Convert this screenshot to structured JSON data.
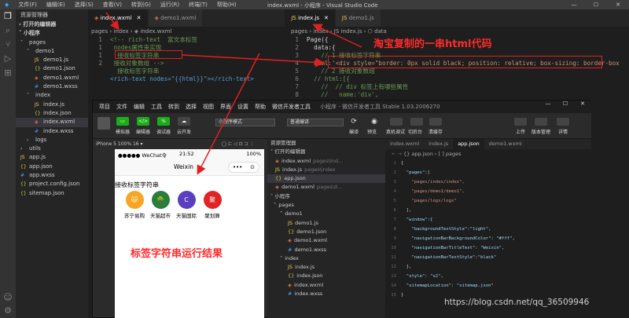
{
  "vscode": {
    "menu": [
      "文件(F)",
      "编辑(E)",
      "选择(S)",
      "查看(V)",
      "转到(G)",
      "运行(R)",
      "终端(T)",
      "帮助(H)"
    ],
    "title": "index.wxml - 小程序 - Visual Studio Code",
    "explorer": {
      "header": "资源管理器",
      "open_editors": "打开的编辑器",
      "project": "小程序",
      "rows": [
        {
          "label": "pages",
          "ind": 6,
          "ic": "˅"
        },
        {
          "label": "demo1",
          "ind": 14,
          "ic": "˅"
        },
        {
          "label": "demo1.js",
          "ind": 24,
          "ic": "JS"
        },
        {
          "label": "demo1.json",
          "ind": 24,
          "ic": "{}"
        },
        {
          "label": "demo1.wxml",
          "ind": 24,
          "ic": "◈"
        },
        {
          "label": "demo1.wxss",
          "ind": 24,
          "ic": "#"
        },
        {
          "label": "index",
          "ind": 14,
          "ic": "˅"
        },
        {
          "label": "index.js",
          "ind": 24,
          "ic": "JS"
        },
        {
          "label": "index.json",
          "ind": 24,
          "ic": "{}"
        },
        {
          "label": "index.wxml",
          "ind": 24,
          "ic": "◈"
        },
        {
          "label": "index.wxss",
          "ind": 24,
          "ic": "#"
        },
        {
          "label": "logs",
          "ind": 14,
          "ic": "›"
        },
        {
          "label": "utils",
          "ind": 6,
          "ic": "›"
        },
        {
          "label": "app.js",
          "ind": 6,
          "ic": "JS"
        },
        {
          "label": "app.json",
          "ind": 6,
          "ic": "{}"
        },
        {
          "label": "app.wxss",
          "ind": 6,
          "ic": "#"
        },
        {
          "label": "project.config.json",
          "ind": 6,
          "ic": "{}"
        },
        {
          "label": "sitemap.json",
          "ind": 6,
          "ic": "{}"
        }
      ]
    },
    "tabs_left": [
      "index.wxml",
      "demo1.wxml"
    ],
    "tabs_right": [
      "index.js",
      "demo1.js"
    ],
    "breadcrumb_left": "pages › index › ◈ index.wxml",
    "breadcrumb_right": "pages › index › JS index.js › ⬡ data",
    "code_left": [
      {
        "n": "1",
        "t": "<!-- rich-text  富文本标签"
      },
      {
        "n": "1",
        "t": " nodes属性来实现"
      },
      {
        "n": "1",
        "t": "  接收标签字符串"
      },
      {
        "n": "2",
        "t": " 接收对象数组 -->"
      },
      {
        "n": "",
        "t": "  接收标签字符串"
      },
      {
        "n": "",
        "t": "<rich-text nodes=\"{{html}}\"></rich-text>"
      }
    ],
    "code_right": [
      {
        "n": "1",
        "t": "Page({"
      },
      {
        "n": "2",
        "t": "  data:{"
      },
      {
        "n": "3",
        "t": "    // 1 接收标签字符串"
      },
      {
        "n": "4",
        "t": "  html:'<div style=\"border: 0px solid black; position: relative; box-sizing: border-box"
      },
      {
        "n": "5",
        "t": "    // 2 接收对象数组"
      },
      {
        "n": "6",
        "t": "  // html:[{"
      },
      {
        "n": "7",
        "t": "    //  // div 标签上有哪些属性"
      },
      {
        "n": "8",
        "t": "    //   name:'div',"
      }
    ],
    "annotation_top": "淘宝复制的一串html代码"
  },
  "devtools": {
    "menu": [
      "项目",
      "文件",
      "编辑",
      "工具",
      "转到",
      "选择",
      "视图",
      "界面",
      "设置",
      "帮助",
      "微信开发者工具"
    ],
    "title": "小程序 - 微信开发者工具 Stable 1.03.2006270",
    "toolbar": {
      "btns": [
        "模拟器",
        "编辑器",
        "调试器",
        "云开发"
      ],
      "mode": "小程序模式",
      "compile": "普通编译",
      "mid": [
        "编译",
        "预览",
        "真机调试",
        "切后台",
        "清缓存"
      ],
      "right": [
        "上传",
        "版本管理",
        "详情"
      ]
    },
    "sim_device": "iPhone 5 100% 16 ▾",
    "phone": {
      "carrier": "●●●●● WeChat令",
      "time": "21:52",
      "battery": "100%",
      "nav_title": "Weixin",
      "rich_text": "接收标签字符串",
      "logos": [
        {
          "name": "苏宁易购",
          "color": "#f6a623",
          "glyph": "🐱"
        },
        {
          "name": "天猫超市",
          "color": "#2a7d3a",
          "glyph": "🌳"
        },
        {
          "name": "天猫国际",
          "color": "#5a3fc0",
          "glyph": "C"
        },
        {
          "name": "聚划算",
          "color": "#e02424",
          "glyph": "聚"
        }
      ]
    },
    "annotation_result": "标签字符串运行结果",
    "explorer": {
      "header": "资源管理器",
      "open_editors": "打开的编辑器",
      "project": "小程序",
      "rows": [
        {
          "label": "index.wxml",
          "ind": 10,
          "ic": "◈",
          "note": "pages\\ind..."
        },
        {
          "label": "index.js",
          "ind": 10,
          "ic": "JS",
          "note": "pages\\index"
        },
        {
          "label": "app.json",
          "ind": 10,
          "ic": "{}",
          "sel": true
        },
        {
          "label": "demo1.wxml",
          "ind": 10,
          "ic": "◈",
          "note": "pages\\d..."
        },
        {
          "label": "",
          "ind": 0,
          "ic": ""
        },
        {
          "label": "pages",
          "ind": 8,
          "ic": "˅"
        },
        {
          "label": "demo1",
          "ind": 16,
          "ic": "˅"
        },
        {
          "label": "demo1.js",
          "ind": 26,
          "ic": "JS"
        },
        {
          "label": "demo1.json",
          "ind": 26,
          "ic": "{}"
        },
        {
          "label": "demo1.wxml",
          "ind": 26,
          "ic": "◈"
        },
        {
          "label": "demo1.wxss",
          "ind": 26,
          "ic": "#"
        },
        {
          "label": "index",
          "ind": 16,
          "ic": "˅"
        },
        {
          "label": "index.js",
          "ind": 26,
          "ic": "JS"
        },
        {
          "label": "index.json",
          "ind": 26,
          "ic": "{}"
        },
        {
          "label": "index.wxml",
          "ind": 26,
          "ic": "◈"
        },
        {
          "label": "index.wxss",
          "ind": 26,
          "ic": "#"
        }
      ]
    },
    "tabs": [
      "index.wxml",
      "index.js",
      "app.json",
      "demo1.wxml"
    ],
    "breadcrumb": "{} app.json › [ ] pages",
    "json_lines": [
      "{",
      "  \"pages\":[",
      "    \"pages/index/index\",",
      "    \"pages/demo1/demo1\",",
      "    \"pages/logs/logs\"",
      "  ],",
      "  \"window\":{",
      "    \"backgroundTextStyle\":\"light\",",
      "    \"navigationBarBackgroundColor\": \"#fff\",",
      "    \"navigationBarTitleText\": \"Weixin\",",
      "    \"navigationBarTextStyle\":\"black\"",
      "  },",
      "  \"style\": \"v2\",",
      "  \"sitemapLocation\": \"sitemap.json\"",
      "}"
    ]
  },
  "watermark": "https://blog.csdn.net/qq_36509946"
}
